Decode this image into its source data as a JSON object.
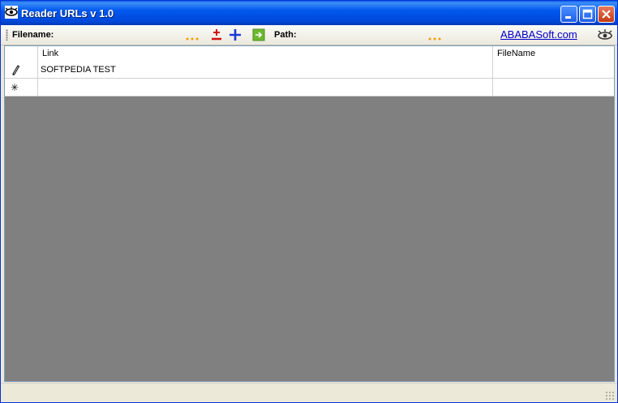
{
  "window": {
    "title": "Reader URLs v 1.0"
  },
  "toolbar": {
    "filename_label": "Filename:",
    "path_label": "Path:",
    "website_link": "ABABASoft.com",
    "icons": {
      "browse_file": "ellipsis-icon",
      "add_remove": "plus-minus-icon",
      "add": "plus-icon",
      "go": "go-arrow-icon",
      "browse_path": "ellipsis-icon",
      "logo": "eye-logo-icon"
    },
    "accent_colors": {
      "ellipsis": "#f0a000",
      "plus_minus": "#d01010",
      "plus": "#1a3ad6",
      "go": "#6cb830"
    }
  },
  "grid": {
    "columns": [
      "Link",
      "FileName"
    ],
    "rows": [
      {
        "marker": "pencil-icon",
        "link": "SOFTPEDIA TEST",
        "filename": ""
      },
      {
        "marker": "new-row-asterisk",
        "link": "",
        "filename": ""
      }
    ],
    "row_markers": {
      "new_row": "✳"
    },
    "empty_background": "#808080"
  }
}
